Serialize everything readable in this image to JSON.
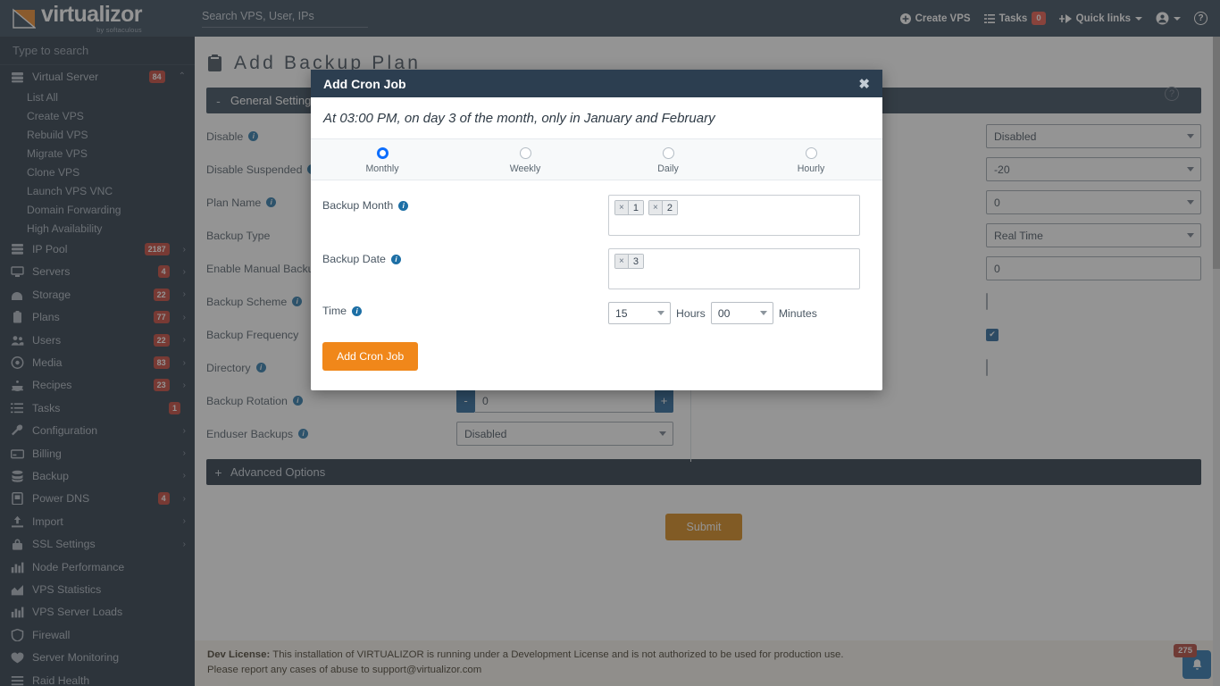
{
  "topbar": {
    "logo_name": "virtualizor",
    "logo_sub": "by softaculous",
    "search_placeholder": "Search VPS, User, IPs",
    "nav": [
      {
        "label": "Create VPS",
        "icon": "plus-circle-icon"
      },
      {
        "label": "Tasks",
        "icon": "tasks-list-icon",
        "badge": "0"
      },
      {
        "label": "Quick links",
        "icon": "quick-links-icon",
        "caret": true
      }
    ],
    "account_icon": "user-circle-icon",
    "help_icon": "question-circle-icon"
  },
  "sidebar": {
    "search_placeholder": "Type to search",
    "items": [
      {
        "label": "Virtual Server",
        "icon": "server-stack-icon",
        "badge": "84",
        "chevron": "up",
        "level": 0
      },
      {
        "label": "List All",
        "icon": "",
        "level": 1
      },
      {
        "label": "Create VPS",
        "icon": "",
        "level": 1
      },
      {
        "label": "Rebuild VPS",
        "icon": "",
        "level": 1
      },
      {
        "label": "Migrate VPS",
        "icon": "",
        "level": 1
      },
      {
        "label": "Clone VPS",
        "icon": "",
        "level": 1
      },
      {
        "label": "Launch VPS VNC",
        "icon": "",
        "level": 1
      },
      {
        "label": "Domain Forwarding",
        "icon": "",
        "level": 1
      },
      {
        "label": "High Availability",
        "icon": "",
        "level": 1
      },
      {
        "label": "IP Pool",
        "icon": "ip-pool-icon",
        "badge": "2187",
        "chevron": "right",
        "level": 0
      },
      {
        "label": "Servers",
        "icon": "servers-icon",
        "badge": "4",
        "chevron": "right",
        "level": 0
      },
      {
        "label": "Storage",
        "icon": "storage-icon",
        "badge": "22",
        "chevron": "right",
        "level": 0
      },
      {
        "label": "Plans",
        "icon": "clipboard-icon",
        "badge": "77",
        "chevron": "right",
        "level": 0
      },
      {
        "label": "Users",
        "icon": "users-icon",
        "badge": "22",
        "chevron": "right",
        "level": 0
      },
      {
        "label": "Media",
        "icon": "disc-icon",
        "badge": "83",
        "chevron": "right",
        "level": 0
      },
      {
        "label": "Recipes",
        "icon": "recipes-icon",
        "badge": "23",
        "chevron": "right",
        "level": 0
      },
      {
        "label": "Tasks",
        "icon": "tasks-icon",
        "badge": "1",
        "level": 0
      },
      {
        "label": "Configuration",
        "icon": "wrench-icon",
        "chevron": "right",
        "level": 0
      },
      {
        "label": "Billing",
        "icon": "billing-card-icon",
        "chevron": "right",
        "level": 0
      },
      {
        "label": "Backup",
        "icon": "database-icon",
        "chevron": "right",
        "level": 0
      },
      {
        "label": "Power DNS",
        "icon": "dns-icon",
        "badge": "4",
        "chevron": "right",
        "level": 0
      },
      {
        "label": "Import",
        "icon": "import-upload-icon",
        "chevron": "right",
        "level": 0
      },
      {
        "label": "SSL Settings",
        "icon": "lock-icon",
        "chevron": "right",
        "level": 0
      },
      {
        "label": "Node Performance",
        "icon": "bar-chart-icon",
        "level": 0
      },
      {
        "label": "VPS Statistics",
        "icon": "area-chart-icon",
        "level": 0
      },
      {
        "label": "VPS Server Loads",
        "icon": "bar-chart-icon",
        "level": 0
      },
      {
        "label": "Firewall",
        "icon": "shield-icon",
        "level": 0
      },
      {
        "label": "Server Monitoring",
        "icon": "heartbeat-icon",
        "level": 0
      },
      {
        "label": "Raid Health",
        "icon": "raid-icon",
        "level": 0
      }
    ]
  },
  "main": {
    "page_title": "Add Backup Plan",
    "page_title_icon": "clipboard-icon",
    "help_icon": "question-circle-icon",
    "general_panel": {
      "sign": "-",
      "title": "General Settings"
    },
    "advanced_panel": {
      "sign": "+",
      "title": "Advanced Options"
    },
    "rows": [
      {
        "label": "Disable",
        "info": true,
        "right_type": "select",
        "right_value": "Disabled"
      },
      {
        "label": "Disable Suspended",
        "info": true,
        "right_type": "select",
        "right_value": "-20"
      },
      {
        "label": "Plan Name",
        "info": true,
        "right_type": "select",
        "right_value": "0"
      },
      {
        "label": "Backup Type",
        "info": false,
        "right_type": "select",
        "right_value": "Real Time"
      },
      {
        "label": "Enable Manual Backup",
        "info": true,
        "right_type": "text",
        "right_value": "0"
      },
      {
        "label": "Backup Scheme",
        "info": true,
        "right_type": "checkbox",
        "right_value": "off"
      },
      {
        "label": "Backup Frequency",
        "info": false,
        "right_type": "checkbox",
        "right_value": "on"
      },
      {
        "label": "Directory",
        "info": true,
        "right_type": "checkbox",
        "right_value": "off"
      }
    ],
    "rotation": {
      "label": "Backup Rotation",
      "minus": "-",
      "value": "0",
      "plus": "+"
    },
    "enduser": {
      "label": "Enduser Backups",
      "value": "Disabled"
    },
    "submit_label": "Submit",
    "footer": {
      "prefix": "Dev License:",
      "line1": " This installation of VIRTUALIZOR is running under a Development License and is not authorized to be used for production use.",
      "line2": "Please report any cases of abuse to support@virtualizor.com"
    },
    "notification": {
      "count": "275",
      "icon": "bell-icon"
    }
  },
  "modal": {
    "title": "Add Cron Job",
    "close_icon": "close-icon",
    "description": "At 03:00 PM, on day 3 of the month, only in January and February",
    "tabs": [
      {
        "label": "Monthly",
        "selected": true
      },
      {
        "label": "Weekly",
        "selected": false
      },
      {
        "label": "Daily",
        "selected": false
      },
      {
        "label": "Hourly",
        "selected": false
      }
    ],
    "backup_month": {
      "label": "Backup Month",
      "tags": [
        "1",
        "2"
      ]
    },
    "backup_date": {
      "label": "Backup Date",
      "tags": [
        "3"
      ]
    },
    "time": {
      "label": "Time",
      "hours": "15",
      "hours_unit": "Hours",
      "minutes": "00",
      "minutes_unit": "Minutes"
    },
    "submit_label": "Add Cron Job"
  },
  "colors": {
    "header_bg": "#2c3e50",
    "sidebar_bg": "#1b2a3a",
    "accent_orange": "#f0871a",
    "badge_red": "#c0392b",
    "radio_blue": "#0d6efd"
  }
}
